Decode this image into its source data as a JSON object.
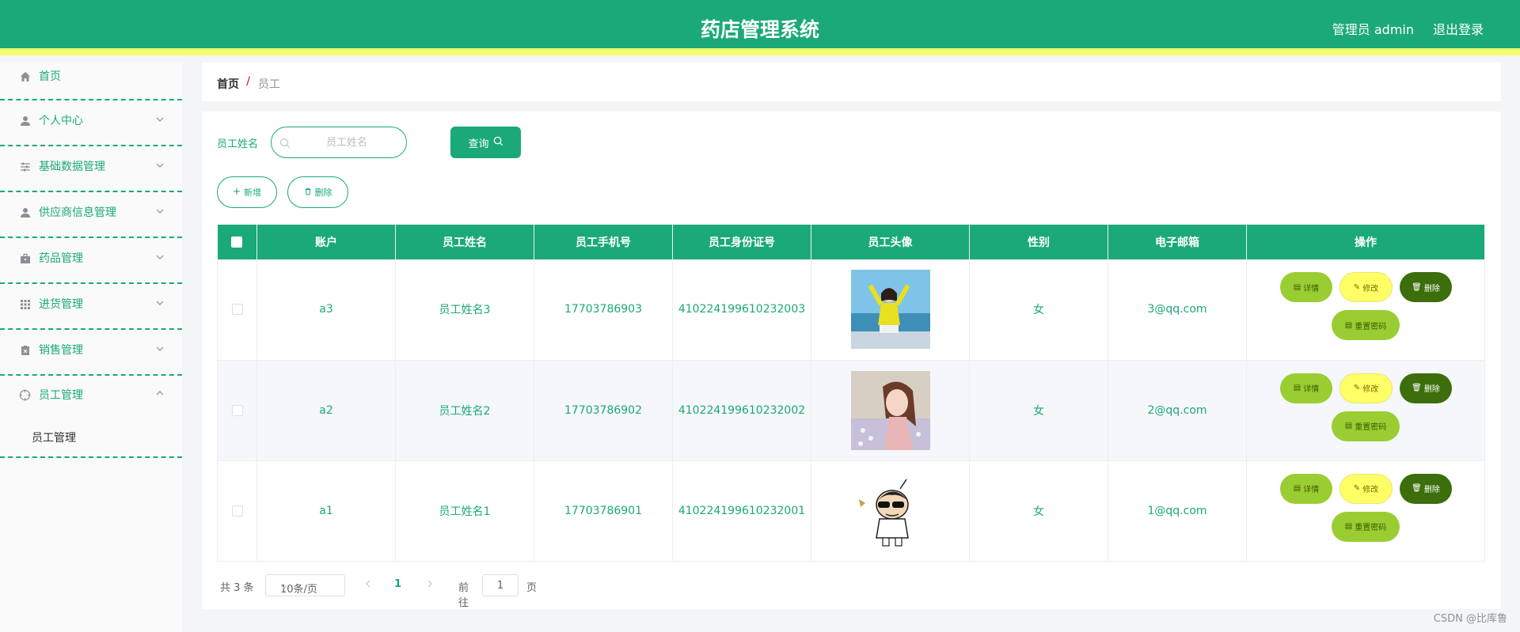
{
  "header": {
    "title": "药店管理系统",
    "admin": "管理员 admin",
    "logout": "退出登录"
  },
  "colors": {
    "primary": "#1ba979",
    "accent_strip": "#f0ff6e",
    "detail": "#9acd32",
    "edit": "#ffff66",
    "remove": "#3c6e0c"
  },
  "sidebar": {
    "items": [
      {
        "label": "首页",
        "icon": "home-icon"
      },
      {
        "label": "个人中心",
        "icon": "user-icon"
      },
      {
        "label": "基础数据管理",
        "icon": "sliders-icon"
      },
      {
        "label": "供应商信息管理",
        "icon": "user-icon"
      },
      {
        "label": "药品管理",
        "icon": "briefcase-icon"
      },
      {
        "label": "进货管理",
        "icon": "grid-icon"
      },
      {
        "label": "销售管理",
        "icon": "clipboard-icon"
      },
      {
        "label": "员工管理",
        "icon": "target-icon",
        "expanded": true,
        "children": [
          {
            "label": "员工管理"
          }
        ]
      }
    ]
  },
  "breadcrumb": {
    "home": "首页",
    "separator": "/",
    "current": "员工"
  },
  "search": {
    "label": "员工姓名",
    "placeholder": "员工姓名",
    "value": "",
    "button": "查询"
  },
  "actions": {
    "add": "新增",
    "delete": "删除"
  },
  "table": {
    "headers": [
      "账户",
      "员工姓名",
      "员工手机号",
      "员工身份证号",
      "员工头像",
      "性别",
      "电子邮箱",
      "操作"
    ],
    "rows": [
      {
        "account": "a3",
        "name": "员工姓名3",
        "phone": "17703786903",
        "id_number": "410224199610232003",
        "avatar": "photo-girl-beach",
        "gender": "女",
        "email": "3@qq.com"
      },
      {
        "account": "a2",
        "name": "员工姓名2",
        "phone": "17703786902",
        "id_number": "410224199610232002",
        "avatar": "photo-girl-flowers",
        "gender": "女",
        "email": "2@qq.com"
      },
      {
        "account": "a1",
        "name": "员工姓名1",
        "phone": "17703786901",
        "id_number": "410224199610232001",
        "avatar": "cartoon-boy-sunglasses",
        "gender": "女",
        "email": "1@qq.com"
      }
    ],
    "row_actions": {
      "detail": "详情",
      "edit": "修改",
      "remove": "删除",
      "reset": "重置密码"
    }
  },
  "pagination": {
    "total": "共 3 条",
    "page_size": "10条/页",
    "current_page": "1",
    "goto": "前往",
    "goto_value": "1",
    "unit": "页"
  },
  "watermark": "CSDN @比库鲁"
}
